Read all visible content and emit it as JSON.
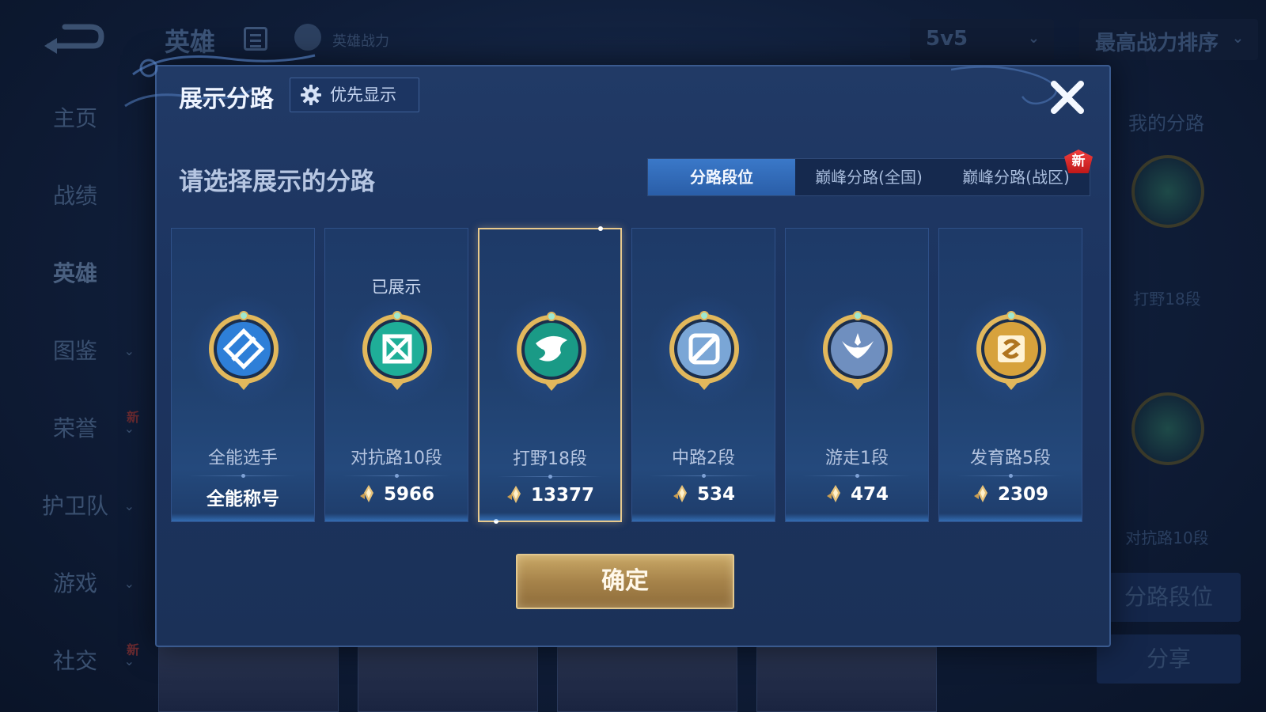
{
  "background": {
    "title": "英雄",
    "power_label": "英雄战力",
    "mode_select": "5v5",
    "sort_select": "最高战力排序",
    "nav": [
      {
        "label": "主页",
        "chevron": false,
        "new": false
      },
      {
        "label": "战绩",
        "chevron": false,
        "new": false
      },
      {
        "label": "英雄",
        "chevron": false,
        "new": false,
        "active": true
      },
      {
        "label": "图鉴",
        "chevron": true,
        "new": false
      },
      {
        "label": "荣誉",
        "chevron": true,
        "new": true
      },
      {
        "label": "护卫队",
        "chevron": true,
        "new": false
      },
      {
        "label": "游戏",
        "chevron": true,
        "new": false
      },
      {
        "label": "社交",
        "chevron": true,
        "new": true
      }
    ],
    "new_badge": "新",
    "right_panel": {
      "header": "我的分路",
      "lanes": [
        "打野18段",
        "对抗路10段"
      ],
      "lane_button": "分路段位",
      "share_button": "分享"
    }
  },
  "modal": {
    "title": "展示分路",
    "priority_button": "优先显示",
    "prompt": "请选择展示的分路",
    "tabs": [
      {
        "label": "分路段位",
        "active": true,
        "new": false
      },
      {
        "label": "巅峰分路(全国)",
        "active": false,
        "new": false
      },
      {
        "label": "巅峰分路(战区)",
        "active": false,
        "new": true
      }
    ],
    "tab_new_badge": "新",
    "cards": [
      {
        "lane": "全能选手",
        "score": "全能称号",
        "has_points": false,
        "shown_label": "",
        "selected": false,
        "emblem": "all-round-emblem-icon",
        "color": "#2e7fd8"
      },
      {
        "lane": "对抗路10段",
        "score": "5966",
        "has_points": true,
        "shown_label": "已展示",
        "selected": false,
        "emblem": "clash-lane-emblem-icon",
        "color": "#1fae98"
      },
      {
        "lane": "打野18段",
        "score": "13377",
        "has_points": true,
        "shown_label": "",
        "selected": true,
        "emblem": "jungle-emblem-icon",
        "color": "#1a9a86"
      },
      {
        "lane": "中路2段",
        "score": "534",
        "has_points": true,
        "shown_label": "",
        "selected": false,
        "emblem": "mid-lane-emblem-icon",
        "color": "#7aa6d6"
      },
      {
        "lane": "游走1段",
        "score": "474",
        "has_points": true,
        "shown_label": "",
        "selected": false,
        "emblem": "roam-emblem-icon",
        "color": "#6f8fbf"
      },
      {
        "lane": "发育路5段",
        "score": "2309",
        "has_points": true,
        "shown_label": "",
        "selected": false,
        "emblem": "farm-lane-emblem-icon",
        "color": "#d7a23c"
      }
    ],
    "confirm_button": "确定"
  }
}
